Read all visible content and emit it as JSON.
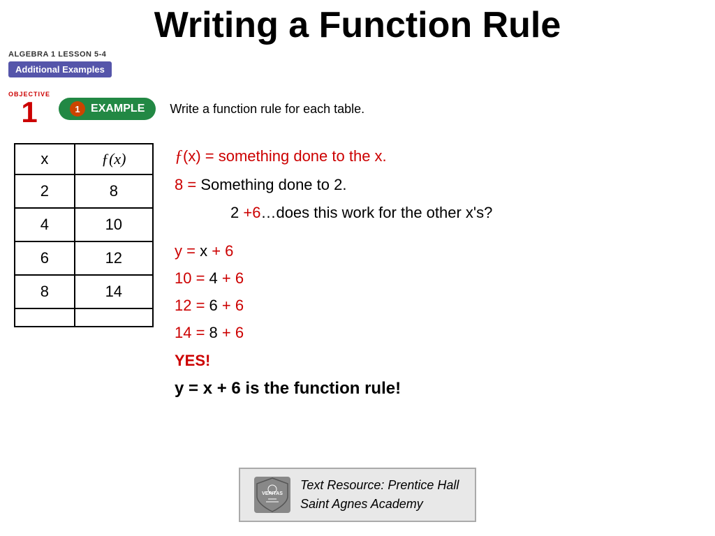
{
  "page": {
    "title": "Writing a Function Rule",
    "lesson_label": "ALGEBRA 1  LESSON 5-4",
    "additional_examples": "Additional Examples",
    "objective_text": "OBJECTIVE",
    "objective_number": "1",
    "example_badge_number": "1",
    "example_badge_text": "EXAMPLE",
    "instruction": "Write a function rule for each table."
  },
  "table": {
    "col1_header": "x",
    "col2_header": "ƒ(x)",
    "rows": [
      {
        "x": "2",
        "fx": "8"
      },
      {
        "x": "4",
        "fx": "10"
      },
      {
        "x": "6",
        "fx": "12"
      },
      {
        "x": "8",
        "fx": "14"
      },
      {
        "x": "",
        "fx": ""
      }
    ]
  },
  "explanation": {
    "line1_italic": "ƒ",
    "line1_rest": "(x) = something done to the x.",
    "line2_red": "8 =",
    "line2_black": "   Something done to 2.",
    "line3_indent": "2 ",
    "line3_red": "+6",
    "line3_black": "…does this work for the other x's?",
    "line4_y_red": "y =",
    "line4_expr": "    x",
    "line4_plus_red": " + 6",
    "line5_red": "10 =",
    "line5_expr": "   4",
    "line5_plus_red": " + 6",
    "line6_red": "12 =",
    "line6_expr": "   6",
    "line6_plus_red": " + 6",
    "line7_red": "14 =",
    "line7_expr": "   8",
    "line7_plus_red": " + 6",
    "yes": "YES!",
    "conclusion": "y = x + 6 is the function rule!"
  },
  "footer": {
    "resource_line1": "Text Resource: Prentice Hall",
    "resource_line2": "Saint Agnes Academy",
    "logo_text": "VERITAS"
  }
}
